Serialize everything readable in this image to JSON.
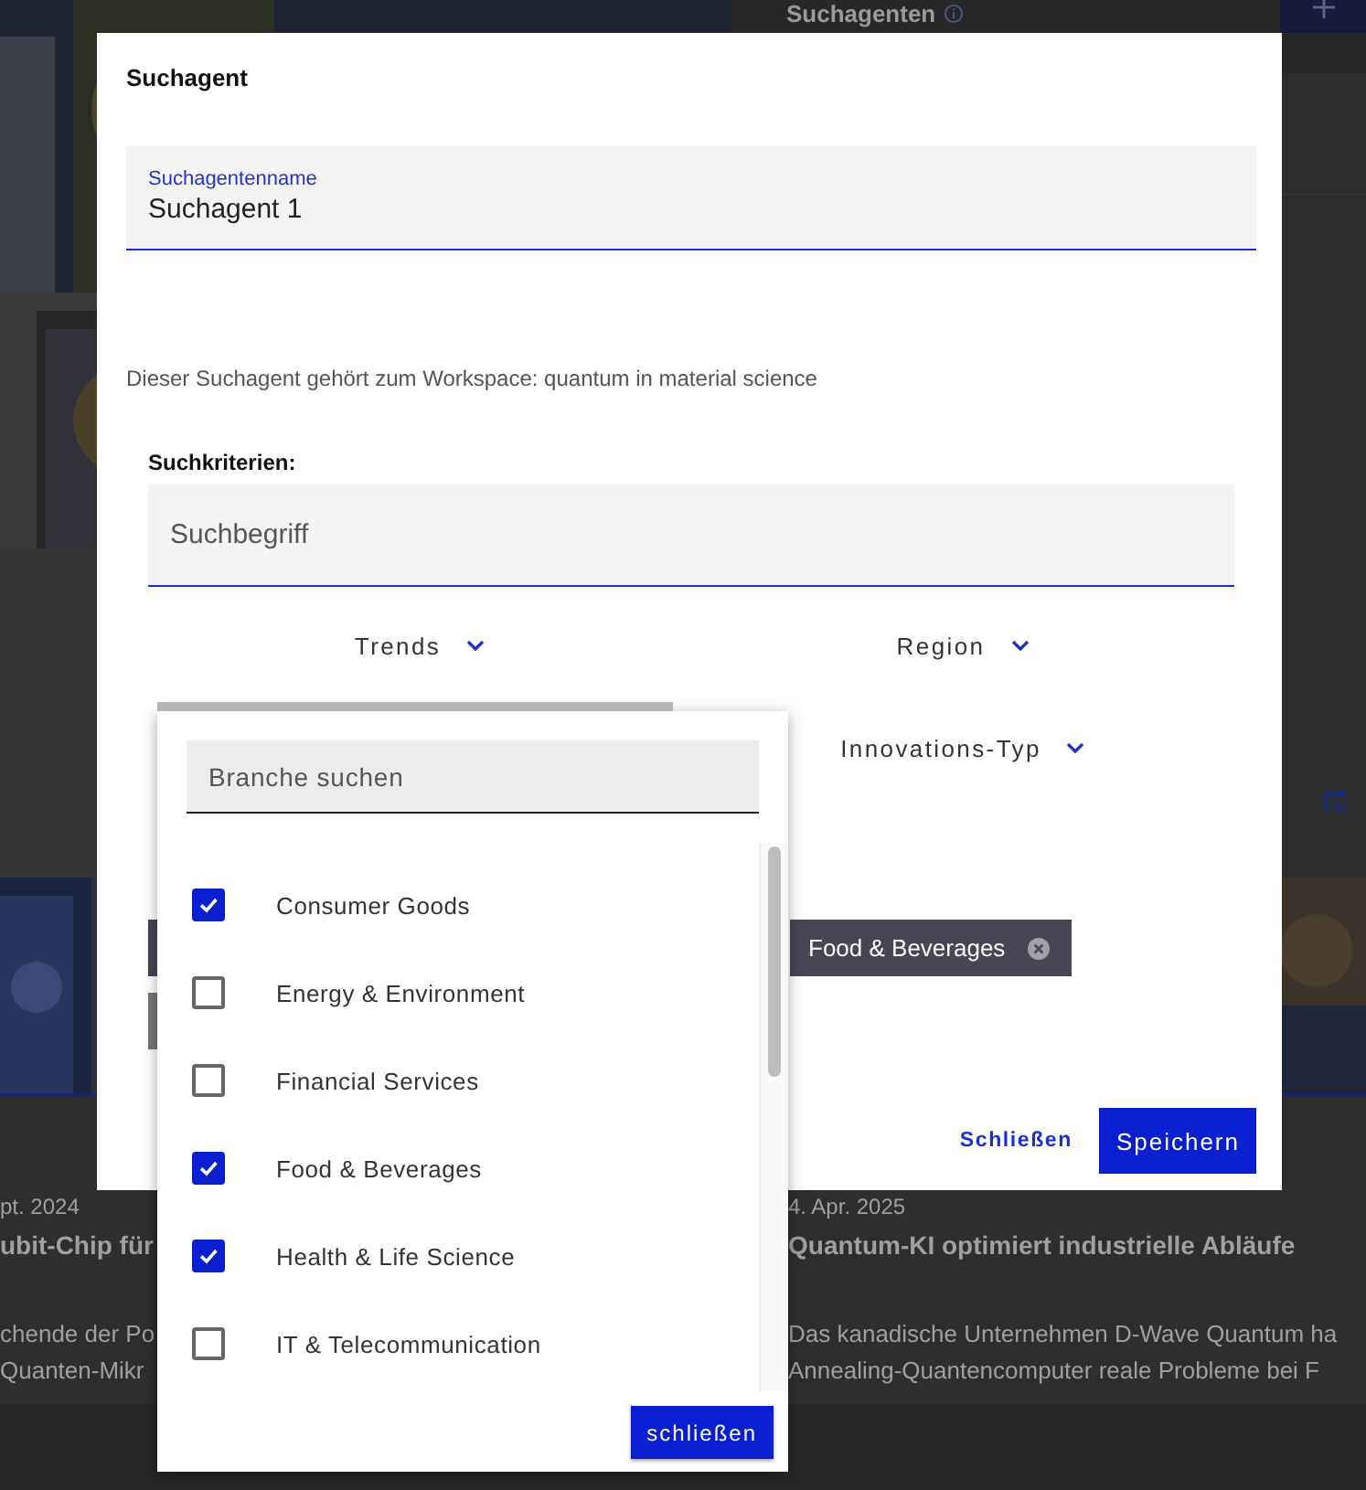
{
  "background": {
    "panel_title": "Suchagenten",
    "articles": [
      {
        "date": "pt. 2024",
        "title": "ubit-Chip für",
        "lines": [
          "chende der Po",
          "Quanten-Mikr"
        ]
      },
      {
        "date": "4. Apr. 2025",
        "title": "Quantum-KI optimiert industrielle Abläufe",
        "lines": [
          "Das kanadische Unternehmen D-Wave Quantum ha",
          "Annealing-Quantencomputer reale Probleme bei F"
        ]
      }
    ]
  },
  "dialog": {
    "title": "Suchagent",
    "name_field": {
      "label": "Suchagentenname",
      "value": "Suchagent 1"
    },
    "workspace_note": "Dieser Suchagent gehört zum Workspace: quantum in material science",
    "criteria_title": "Suchkriterien:",
    "search_field": {
      "placeholder": "Suchbegriff"
    },
    "filters": [
      {
        "label": "Trends"
      },
      {
        "label": "Region"
      },
      {
        "label": "Innovations-Typ"
      }
    ],
    "tags": [
      {
        "label": "Food & Beverages"
      }
    ],
    "buttons": [
      {
        "label": "Schließen",
        "kind": "text"
      },
      {
        "label": "Speichern",
        "kind": "primary"
      }
    ]
  },
  "dropdown": {
    "search": {
      "placeholder": "Branche suchen"
    },
    "options": [
      {
        "label": "Consumer Goods",
        "checked": true
      },
      {
        "label": "Energy & Environment",
        "checked": false
      },
      {
        "label": "Financial Services",
        "checked": false
      },
      {
        "label": "Food & Beverages",
        "checked": true
      },
      {
        "label": "Health & Life Science",
        "checked": true
      },
      {
        "label": "IT & Telecommunication",
        "checked": false
      }
    ],
    "close_button": "schließen"
  }
}
